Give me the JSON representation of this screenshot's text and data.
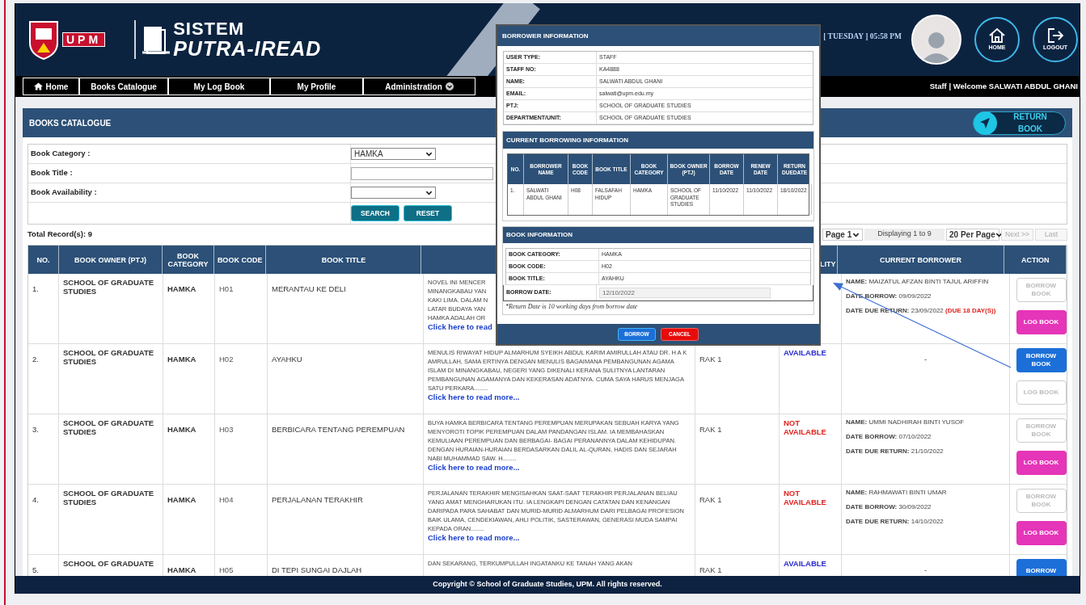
{
  "header": {
    "logo_text": "UPM",
    "system_title": "SISTEM",
    "system_name": "PUTRA-IREAD",
    "datetime": "[ TUESDAY ] 05:58 PM",
    "home_label": "HOME",
    "logout_label": "LOGOUT"
  },
  "nav": [
    {
      "label": "Home",
      "kind": "home"
    },
    {
      "label": "Books Catalogue",
      "kind": "link"
    },
    {
      "label": "My Log Book",
      "kind": "link"
    },
    {
      "label": "My Profile",
      "kind": "link"
    },
    {
      "label": "Administration",
      "kind": "dropdown"
    }
  ],
  "welcome": "Staff | Welcome SALWATI ABDUL GHANI",
  "page_title": "BOOKS CATALOGUE",
  "return_button": "RETURN BOOK",
  "filters": [
    {
      "label": "Book Category :",
      "kind": "select",
      "value": "HAMKA"
    },
    {
      "label": "Book Title :",
      "kind": "text"
    },
    {
      "label": "Book Availability :",
      "kind": "select"
    }
  ],
  "filter_buttons": [
    "SEARCH",
    "RESET"
  ],
  "total": "Total Record(s): 9",
  "pagination": [
    {
      "text": "Page 1",
      "kind": "select"
    },
    {
      "text": "Displaying 1 to 9",
      "kind": "info"
    },
    {
      "text": "20 Per Page",
      "kind": "select"
    },
    {
      "text": "Next >>",
      "kind": "link",
      "disabled": true
    },
    {
      "text": "Last",
      "kind": "link",
      "disabled": true
    }
  ],
  "table": {
    "columns": [
      {
        "label": "NO."
      },
      {
        "label": "BOOK OWNER (PTJ)"
      },
      {
        "label": "BOOK CATEGORY"
      },
      {
        "label": "BOOK CODE"
      },
      {
        "label": "BOOK TITLE"
      },
      {},
      {},
      {
        "label": "LITY",
        "clipped": true
      },
      {
        "label": "CURRENT BORROWER"
      },
      {
        "label": "ACTION"
      }
    ],
    "rows": [
      {
        "no": "1.",
        "owner": "SCHOOL OF GRADUATE STUDIES",
        "category": "HAMKA",
        "code": "H01",
        "title": "MERANTAU KE DELI",
        "description": "NOVEL INI MENCER\nMINANGKABAU YAN\nKAKI LIMA. DALAM N\nLATAR BUDAYA YAN\nHAMKA ADALAH OR",
        "read_more": "Click here to read",
        "borrower": [
          {
            "label": "NAME:",
            "value": "MAIZATUL AFZAN BINTI TAJUL ARIFFIN"
          },
          {
            "label": "DATE BORROW:",
            "value": "09/09/2022"
          },
          {
            "label": "DATE DUE RETURN:",
            "value": "23/09/2022",
            "note": "(DUE 18 DAY(S))"
          }
        ],
        "actions": [
          {
            "label": "BORROW BOOK",
            "kind": "borrow",
            "disabled": true
          },
          {
            "label": "LOG BOOK",
            "kind": "log",
            "disabled": false
          }
        ]
      },
      {
        "no": "2.",
        "owner": "SCHOOL OF GRADUATE STUDIES",
        "category": "HAMKA",
        "code": "H02",
        "title": "AYAHKU",
        "description": "MENULIS RIWAYAT HIDUP ALMARHUM SYEIKH ABDUL KARIM AMIRULLAH ATAU DR. H A K AMRULLAH, SAMA ERTINYA DENGAN MENULIS BAGAIMANA PEMBANGUNAN AGAMA ISLAM DI MINANGKABAU, NEGERI YANG DIKENALI KERANA SULITNYA LANTARAN PEMBANGUNAN AGAMANYA DAN KEKERASAN ADATNYA. CUMA SAYA HARUS MENJAGA SATU PERKARA........",
        "read_more": "Click here to read more...",
        "location": "RAK 1",
        "availability": "AVAILABLE",
        "color": "#2a2ad0",
        "borrower_text": "-",
        "actions": [
          {
            "label": "BORROW BOOK",
            "kind": "borrow",
            "disabled": false
          },
          {
            "label": "LOG BOOK",
            "kind": "log",
            "disabled": true
          }
        ]
      },
      {
        "no": "3.",
        "owner": "SCHOOL OF GRADUATE STUDIES",
        "category": "HAMKA",
        "code": "H03",
        "title": "BERBICARA TENTANG PEREMPUAN",
        "description": "BUYA HAMKA BERBICARA TENTANG PEREMPUAN MERUPAKAN SEBUAH KARYA YANG MENYOROTI TOPIK PEREMPUAN DALAM PANDANGAN ISLAM. IA MEMBAHASKAN KEMULIAAN PEREMPUAN DAN BERBAGAI- BAGAI PERANANNYA DALAM KEHIDUPAN. DENGAN HURAIAN-HURAIAN BERDASARKAN DALIL AL-QURAN, HADIS DAN SEJARAH NABI MUHAMMAD SAW. H........",
        "read_more": "Click here to read more...",
        "location": "RAK 1",
        "availability": "NOT AVAILABLE",
        "color": "#e0211d",
        "borrower": [
          {
            "label": "NAME:",
            "value": "UMMI NADHIRAH BINTI YUSOF"
          },
          {
            "label": "DATE BORROW:",
            "value": "07/10/2022"
          },
          {
            "label": "DATE DUE RETURN:",
            "value": "21/10/2022"
          }
        ],
        "actions": [
          {
            "label": "BORROW BOOK",
            "kind": "borrow",
            "disabled": true
          },
          {
            "label": "LOG BOOK",
            "kind": "log",
            "disabled": false
          }
        ]
      },
      {
        "no": "4.",
        "owner": "SCHOOL OF GRADUATE STUDIES",
        "category": "HAMKA",
        "code": "H04",
        "title": "PERJALANAN TERAKHIR",
        "description": "PERJALANAN TERAKHIR MENGISAHKAN SAAT-SAAT TERAKHIR PERJALANAN BELIAU YANG AMAT MENGHARUKAN ITU. IA LENGKAPI DENGAN CATATAN DAN KENANGAN DARIPADA PARA SAHABAT DAN MURID-MURID ALMARHUM DARI PELBAGAI PROFESION BAIK ULAMA, CENDEKIAWAN, AHLI POLITIK, SASTERAWAN, GENERASI MUDA SAMPAI KEPADA ORAN........",
        "read_more": "Click here to read more...",
        "location": "RAK 1",
        "availability": "NOT AVAILABLE",
        "color": "#e0211d",
        "borrower": [
          {
            "label": "NAME:",
            "value": "RAHMAWATI BINTI UMAR"
          },
          {
            "label": "DATE BORROW:",
            "value": "30/09/2022"
          },
          {
            "label": "DATE DUE RETURN:",
            "value": "14/10/2022"
          }
        ],
        "actions": [
          {
            "label": "BORROW BOOK",
            "kind": "borrow",
            "disabled": true
          },
          {
            "label": "LOG BOOK",
            "kind": "log",
            "disabled": false
          }
        ]
      },
      {
        "no": "5.",
        "owner": "SCHOOL OF GRADUATE",
        "category": "HAMKA",
        "code": "H05",
        "title": "DI TEPI SUNGAI DAJLAH",
        "description": "DAN SEKARANG, TERKUMPULLAH INGATANKU KE TANAH YANG AKAN",
        "location": "RAK 1",
        "availability": "AVAILABLE",
        "color": "#2a2ad0",
        "borrower_text": "-",
        "actions": [
          {
            "label": "BORROW",
            "kind": "borrow",
            "disabled": false
          }
        ]
      }
    ]
  },
  "modal": {
    "title": "BORROWER INFORMATION",
    "borrower_info": [
      {
        "label": "USER TYPE:",
        "value": "STAFF"
      },
      {
        "label": "STAFF NO:",
        "value": "KA4888"
      },
      {
        "label": "NAME:",
        "value": "SALWATI ABDUL GHANI"
      },
      {
        "label": "EMAIL:",
        "value": "salwati@upm.edu.my"
      },
      {
        "label": "PTJ:",
        "value": "SCHOOL OF GRADUATE STUDIES"
      },
      {
        "label": "DEPARTMENT/UNIT:",
        "value": "SCHOOL OF GRADUATE STUDIES"
      }
    ],
    "current_title": "CURRENT BORROWING INFORMATION",
    "current_columns": [
      "NO.",
      "BORROWER NAME",
      "BOOK CODE",
      "BOOK TITLE",
      "BOOK CATEGORY",
      "BOOK OWNER (PTJ)",
      "BORROW DATE",
      "RENEW DATE",
      "RETURN DUEDATE"
    ],
    "current_rows": [
      [
        "1.",
        "SALWATI ABDUL GHANI",
        "H08",
        "FALSAFAH HIDUP",
        "HAMKA",
        "SCHOOL OF GRADUATE STUDIES",
        "11/10/2022",
        "11/10/2022",
        "18/10/2022"
      ]
    ],
    "book_title": "BOOK INFORMATION",
    "book_info": [
      {
        "label": "BOOK CATEGORY:",
        "value": "HAMKA"
      },
      {
        "label": "BOOK CODE:",
        "value": "H02"
      },
      {
        "label": "BOOK TITLE:",
        "value": "AYAHKU"
      }
    ],
    "borrow_date": {
      "label": "BORROW DATE:",
      "value": "12/10/2022"
    },
    "note": "*Return Date is 10 working days from borrow date",
    "buttons": [
      {
        "label": "BORROW",
        "kind": "primary"
      },
      {
        "label": "CANCEL",
        "kind": "danger"
      }
    ]
  },
  "footer": "Copyright © School of Graduate Studies, UPM. All rights reserved."
}
